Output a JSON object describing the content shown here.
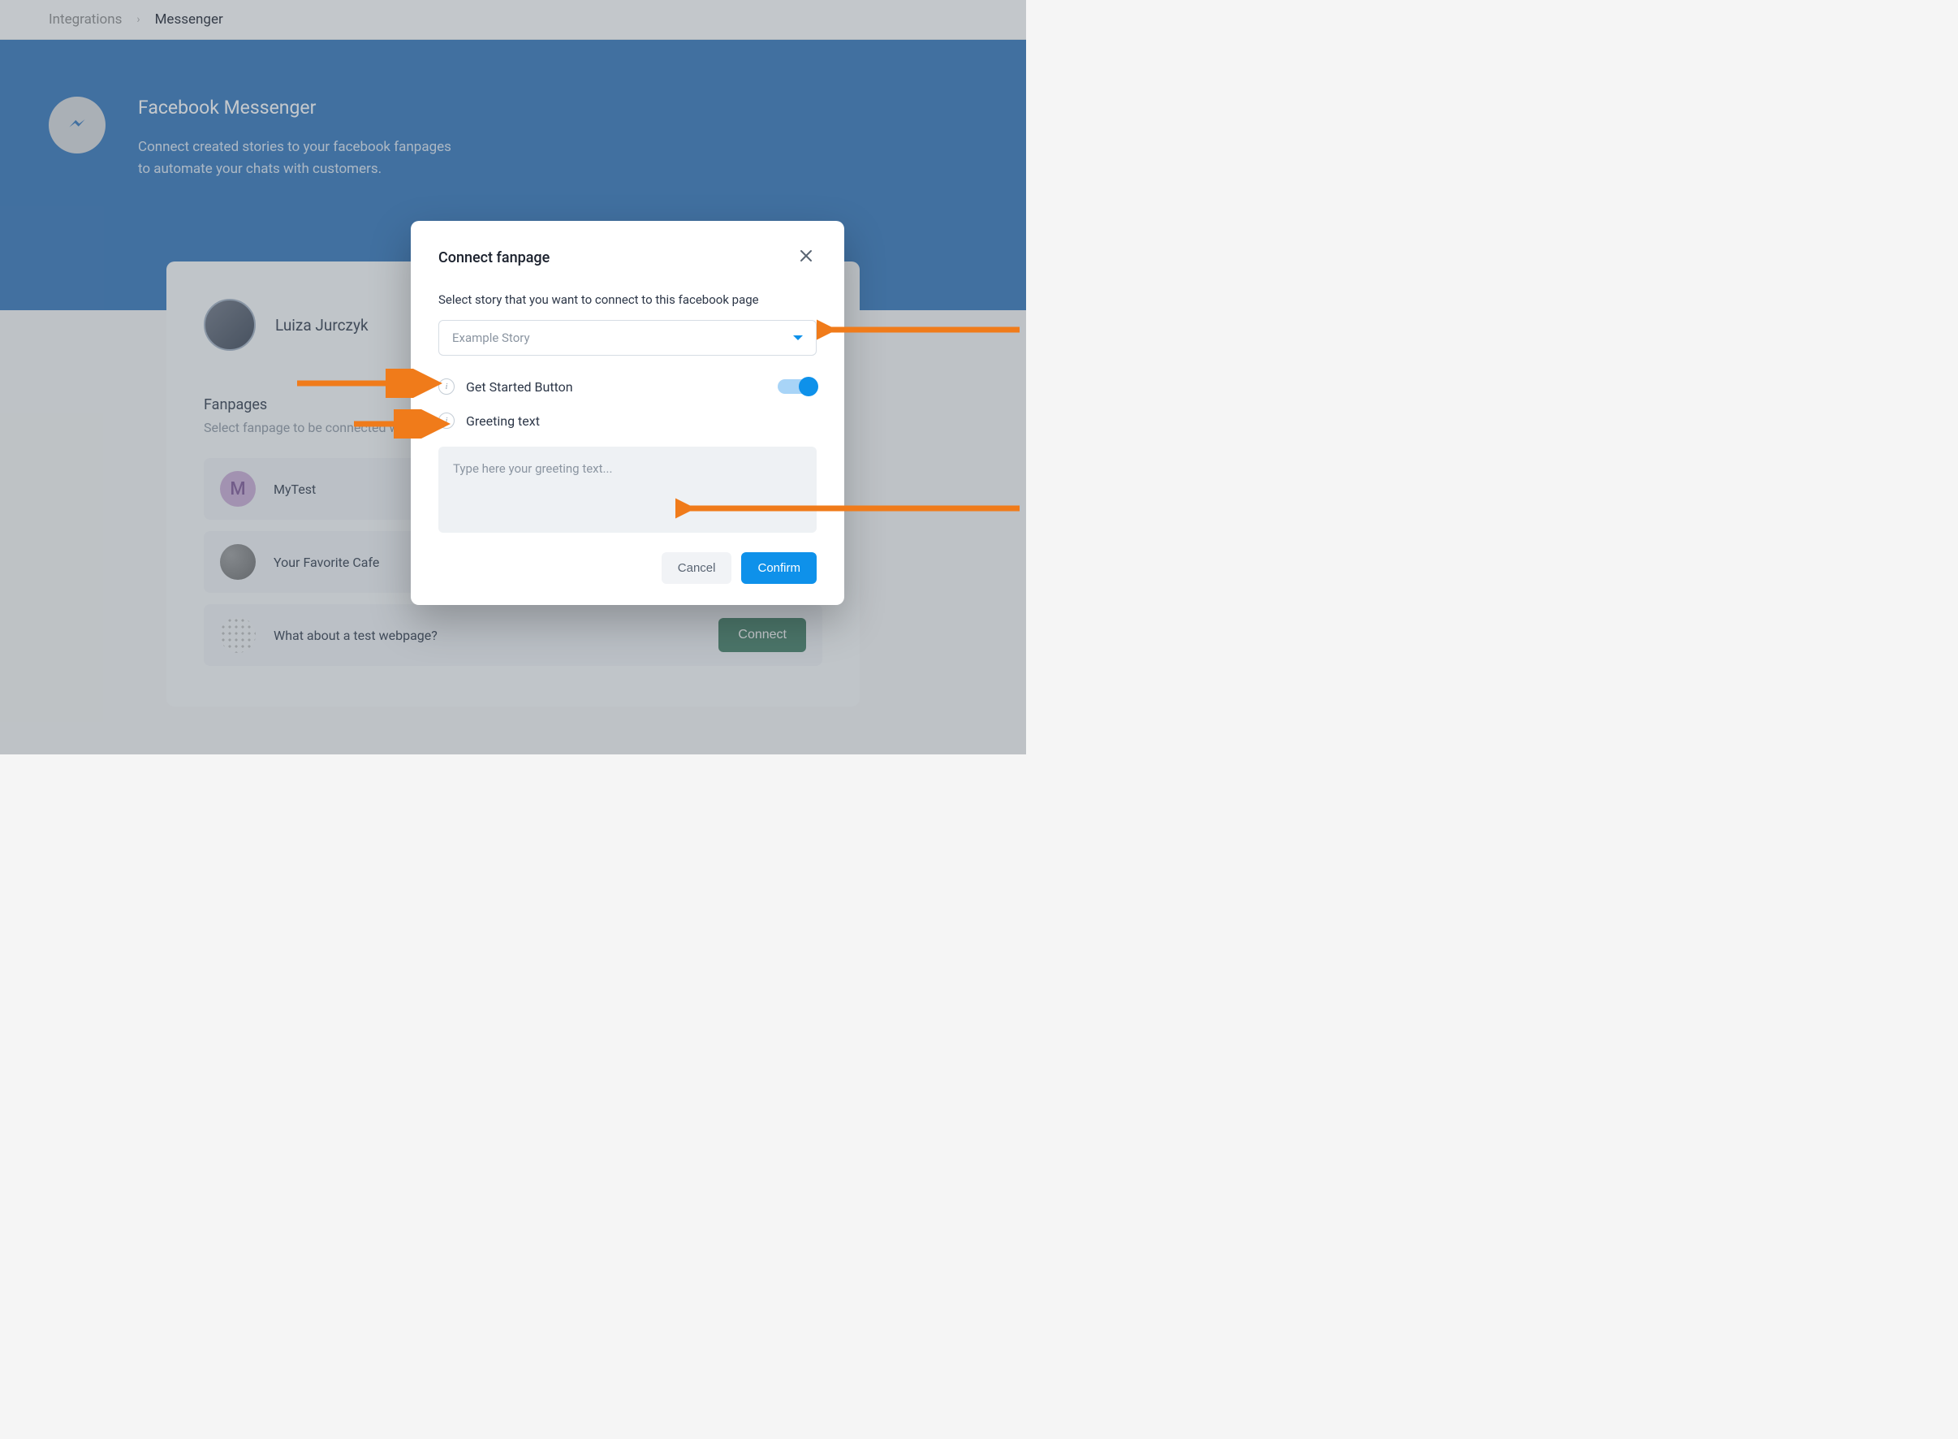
{
  "breadcrumb": {
    "parent": "Integrations",
    "current": "Messenger"
  },
  "hero": {
    "title": "Facebook Messenger",
    "desc_line1": "Connect created stories to your facebook fanpages",
    "desc_line2": "to automate your chats with customers."
  },
  "user": {
    "name": "Luiza Jurczyk"
  },
  "fanpages": {
    "title": "Fanpages",
    "subtitle": "Select fanpage to be connected with",
    "items": [
      {
        "letter": "M",
        "name": "MyTest"
      },
      {
        "letter": "",
        "name": "Your Favorite Cafe"
      },
      {
        "letter": "",
        "name": "What about a test webpage?"
      }
    ],
    "connect_label": "Connect"
  },
  "modal": {
    "title": "Connect fanpage",
    "select_label": "Select story that you want to connect to this facebook page",
    "selected_story": "Example Story",
    "option_get_started": "Get Started Button",
    "option_greeting": "Greeting text",
    "greeting_placeholder": "Type here your greeting text...",
    "cancel_label": "Cancel",
    "confirm_label": "Confirm"
  }
}
